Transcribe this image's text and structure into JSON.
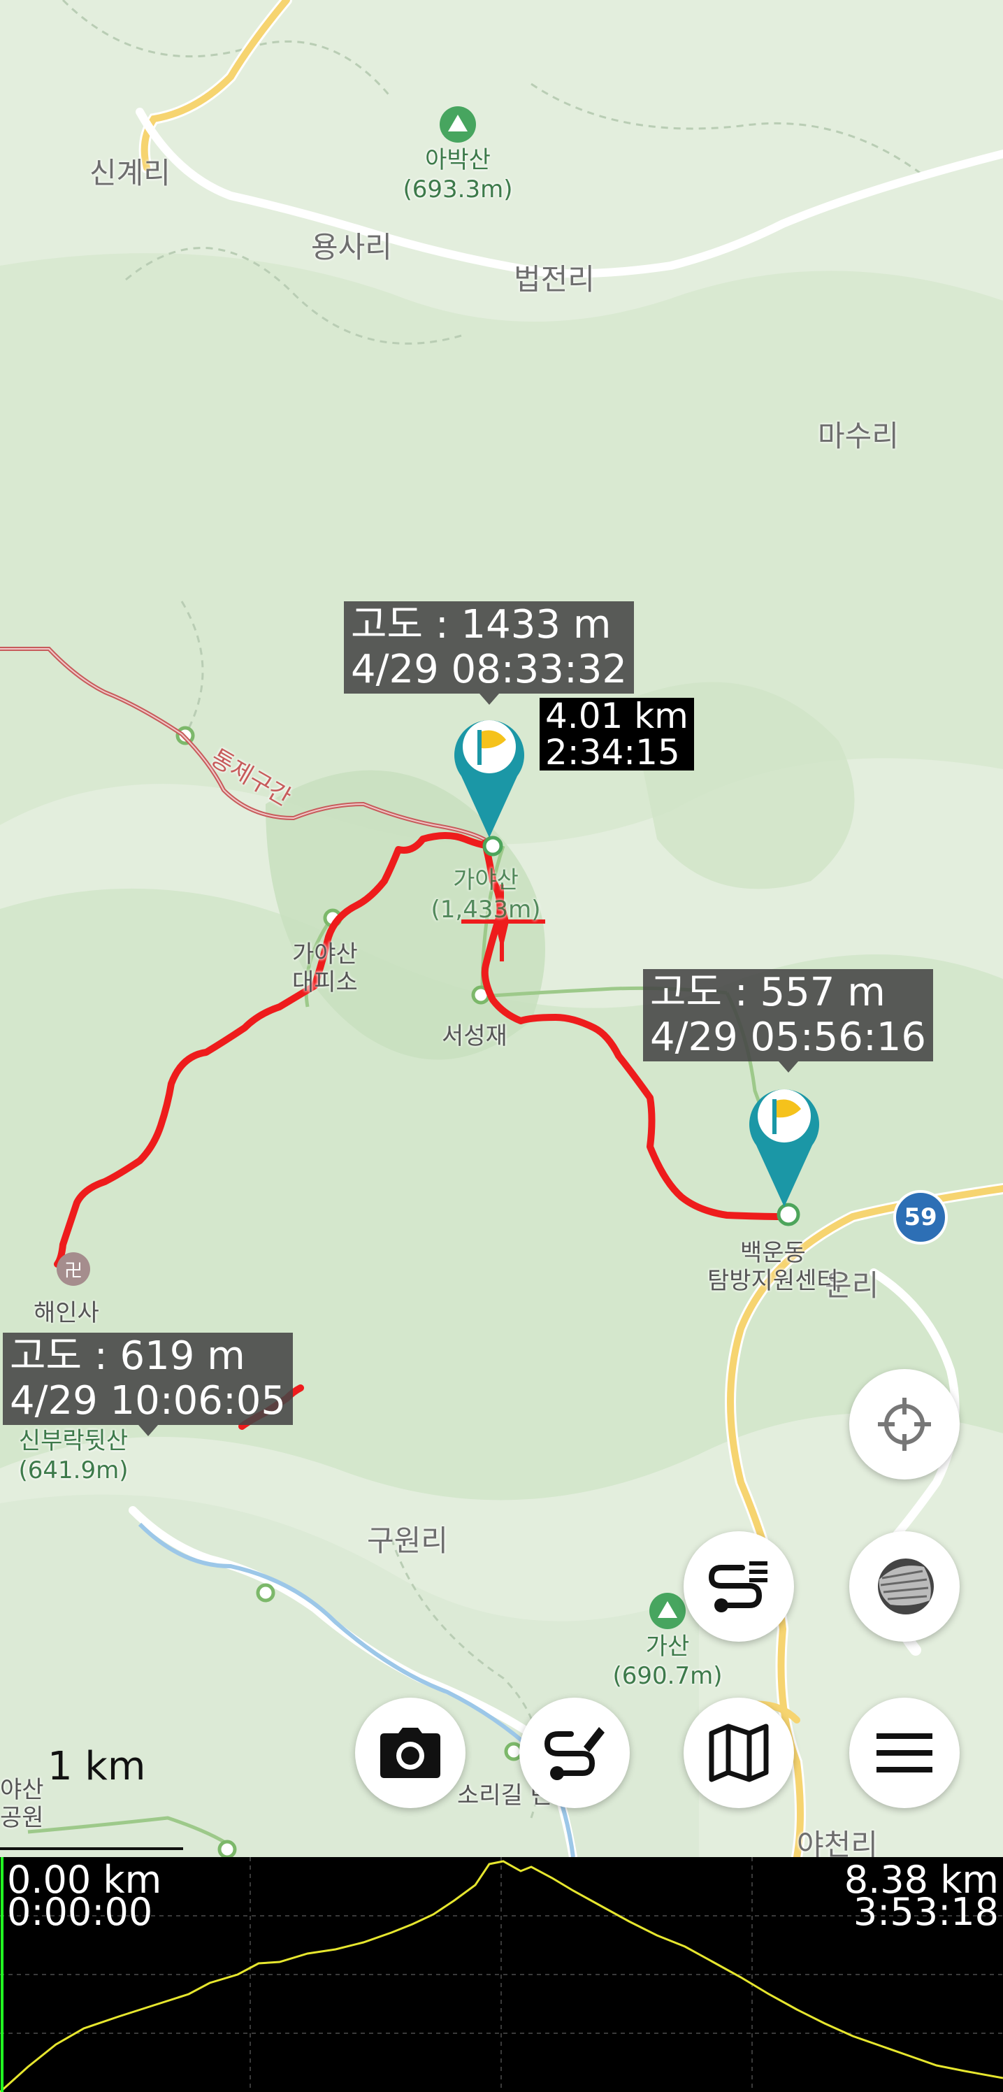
{
  "map": {
    "places": [
      {
        "id": "singyeri",
        "label": "신계리"
      },
      {
        "id": "yongsari",
        "label": "용사리"
      },
      {
        "id": "beopjeonri",
        "label": "법전리"
      },
      {
        "id": "masuri",
        "label": "마수리"
      },
      {
        "id": "guwonri",
        "label": "구원리"
      },
      {
        "id": "yacheonri",
        "label": "야천리"
      },
      {
        "id": "unri",
        "label": "운리"
      },
      {
        "id": "haeinsa",
        "label": "해인사"
      },
      {
        "id": "baegundong",
        "label": "백운동\n탐방지원센터"
      },
      {
        "id": "gayasan_shelter",
        "label": "가야산\n대피소"
      },
      {
        "id": "seoseongjae",
        "label": "서성재"
      },
      {
        "id": "tongjeguigan",
        "label": "통제구간"
      },
      {
        "id": "sorigil",
        "label": "소리길 번"
      },
      {
        "id": "gayasan_park",
        "label": "야산\n공원"
      }
    ],
    "peaks": [
      {
        "id": "abaksan",
        "name": "아박산",
        "elev": "(693.3m)"
      },
      {
        "id": "gasan",
        "name": "가산",
        "elev": "(690.7m)"
      },
      {
        "id": "sinburak",
        "name": "신부락뒷산",
        "elev": "(641.9m)"
      },
      {
        "id": "gayasan_summit",
        "name": "가야산",
        "elev": "(1,433m)"
      }
    ],
    "route_badge": "59",
    "callouts": {
      "summit": {
        "alt": "고도 : 1433 m",
        "time": "4/29 08:33:32"
      },
      "start": {
        "alt": "고도 : 557 m",
        "time": "4/29 05:56:16"
      },
      "end": {
        "alt": "고도 : 619 m",
        "time": "4/29 10:06:05"
      }
    },
    "distance_label": {
      "dist": "4.01 km",
      "time": "2:34:15"
    },
    "scale": "1 km",
    "colors": {
      "track": "#ee1c1c",
      "pin": "#1b97a6",
      "flag": "#f5c21b",
      "restricted": "#c85a5a"
    }
  },
  "buttons": {
    "locate": "crosshair-icon",
    "layers": "layers-icon",
    "route": "route-list-icon",
    "camera": "camera-icon",
    "draw": "draw-route-icon",
    "map": "map-icon",
    "menu": "menu-icon"
  },
  "profile": {
    "start_dist": "0.00 km",
    "start_time": "0:00:00",
    "end_dist": "8.38 km",
    "end_time": "3:53:18",
    "line_color": "#e6e62e",
    "cursor_color": "#22ff22"
  }
}
